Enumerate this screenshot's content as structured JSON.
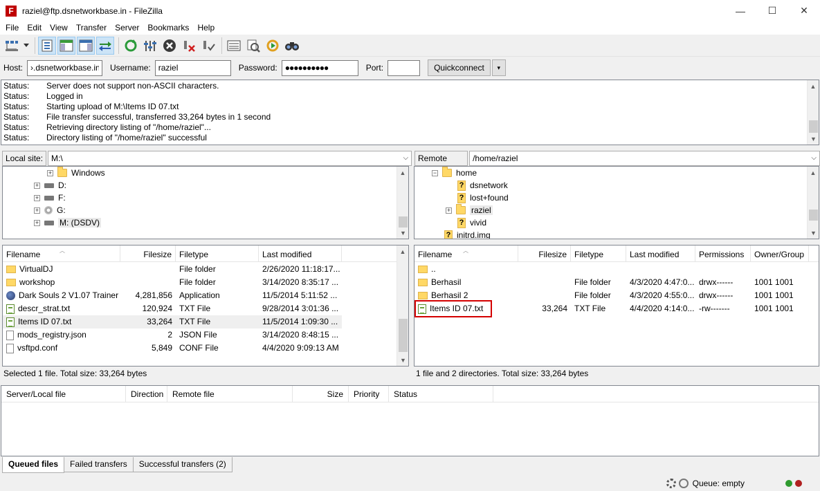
{
  "window": {
    "title": "raziel@ftp.dsnetworkbase.in - FileZilla",
    "app_icon_letter": "F",
    "minimize": "—",
    "maximize": "☐",
    "close": "✕"
  },
  "menu": [
    "File",
    "Edit",
    "View",
    "Transfer",
    "Server",
    "Bookmarks",
    "Help"
  ],
  "toolbar": {
    "icons": [
      "site-manager-icon",
      "dropdown-arrow-icon",
      "toggle-log-icon",
      "toggle-local-tree-icon",
      "toggle-remote-tree-icon",
      "toggle-queue-icon",
      "refresh-icon",
      "process-queue-icon",
      "cancel-icon",
      "disconnect-icon",
      "reconnect-icon",
      "directory-listing-filters-icon",
      "toggle-comparison-icon",
      "sync-browsing-icon",
      "search-files-icon"
    ]
  },
  "quickconnect": {
    "host_label": "Host:",
    "host_value": "›.dsnetworkbase.in",
    "username_label": "Username:",
    "username_value": "raziel",
    "password_label": "Password:",
    "password_value": "●●●●●●●●●●",
    "port_label": "Port:",
    "port_value": "",
    "button_label": "Quickconnect",
    "dropdown": "▾"
  },
  "log": [
    {
      "type": "Status:",
      "message": "Server does not support non-ASCII characters."
    },
    {
      "type": "Status:",
      "message": "Logged in"
    },
    {
      "type": "Status:",
      "message": "Starting upload of M:\\Items ID 07.txt"
    },
    {
      "type": "Status:",
      "message": "File transfer successful, transferred 33,264 bytes in 1 second"
    },
    {
      "type": "Status:",
      "message": "Retrieving directory listing of \"/home/raziel\"..."
    },
    {
      "type": "Status:",
      "message": "Directory listing of \"/home/raziel\" successful"
    }
  ],
  "local": {
    "site_label": "Local site:",
    "site_path": "M:\\",
    "tree": [
      {
        "label": "Windows",
        "expander": "+",
        "icon": "folder-icon"
      },
      {
        "label": "D:",
        "expander": "+",
        "icon": "drive-icon"
      },
      {
        "label": "F:",
        "expander": "+",
        "icon": "drive-icon"
      },
      {
        "label": "G:",
        "expander": "+",
        "icon": "cd-icon"
      },
      {
        "label": "M: (DSDV)",
        "expander": "+",
        "icon": "drive-icon"
      }
    ],
    "columns": {
      "name": "Filename",
      "size": "Filesize",
      "type": "Filetype",
      "modified": "Last modified"
    },
    "files": [
      {
        "name": "VirtualDJ",
        "size": "",
        "type": "File folder",
        "modified": "2/26/2020 11:18:17...",
        "icon": "folder-icon"
      },
      {
        "name": "workshop",
        "size": "",
        "type": "File folder",
        "modified": "3/14/2020 8:35:17 ...",
        "icon": "folder-icon"
      },
      {
        "name": "Dark Souls 2 V1.07 Trainer ...",
        "size": "4,281,856",
        "type": "Application",
        "modified": "11/5/2014 5:11:52 ...",
        "icon": "application-icon"
      },
      {
        "name": "descr_strat.txt",
        "size": "120,924",
        "type": "TXT File",
        "modified": "9/28/2014 3:01:36 ...",
        "icon": "text-file-icon"
      },
      {
        "name": "Items ID 07.txt",
        "size": "33,264",
        "type": "TXT File",
        "modified": "11/5/2014 1:09:30 ...",
        "icon": "text-file-icon"
      },
      {
        "name": "mods_registry.json",
        "size": "2",
        "type": "JSON File",
        "modified": "3/14/2020 8:48:15 ...",
        "icon": "file-icon"
      },
      {
        "name": "vsftpd.conf",
        "size": "5,849",
        "type": "CONF File",
        "modified": "4/4/2020 9:09:13 AM",
        "icon": "file-icon"
      }
    ],
    "status": "Selected 1 file. Total size: 33,264 bytes"
  },
  "remote": {
    "site_label": "Remote site:",
    "site_path": "/home/raziel",
    "tree": [
      {
        "label": "home",
        "expander": "−",
        "icon": "folder-icon"
      },
      {
        "label": "dsnetwork",
        "expander": "",
        "icon": "unknown-folder-icon"
      },
      {
        "label": "lost+found",
        "expander": "",
        "icon": "unknown-folder-icon"
      },
      {
        "label": "raziel",
        "expander": "+",
        "icon": "folder-icon"
      },
      {
        "label": "vivid",
        "expander": "",
        "icon": "unknown-folder-icon"
      },
      {
        "label": "initrd.img",
        "expander": "",
        "icon": "unknown-folder-icon"
      }
    ],
    "unknown_glyph": "?",
    "columns": {
      "name": "Filename",
      "size": "Filesize",
      "type": "Filetype",
      "modified": "Last modified",
      "permissions": "Permissions",
      "owner": "Owner/Group"
    },
    "files": [
      {
        "name": "..",
        "size": "",
        "type": "",
        "modified": "",
        "permissions": "",
        "owner": "",
        "icon": "folder-icon"
      },
      {
        "name": "Berhasil",
        "size": "",
        "type": "File folder",
        "modified": "4/3/2020 4:47:0...",
        "permissions": "drwx------",
        "owner": "1001 1001",
        "icon": "folder-icon"
      },
      {
        "name": "Berhasil 2",
        "size": "",
        "type": "File folder",
        "modified": "4/3/2020 4:55:0...",
        "permissions": "drwx------",
        "owner": "1001 1001",
        "icon": "folder-icon"
      },
      {
        "name": "Items ID 07.txt",
        "size": "33,264",
        "type": "TXT File",
        "modified": "4/4/2020 4:14:0...",
        "permissions": "-rw-------",
        "owner": "1001 1001",
        "icon": "text-file-icon"
      }
    ],
    "status": "1 file and 2 directories. Total size: 33,264 bytes"
  },
  "queue": {
    "columns": {
      "server_local": "Server/Local file",
      "direction": "Direction",
      "remote": "Remote file",
      "size": "Size",
      "priority": "Priority",
      "status": "Status"
    },
    "tabs": [
      "Queued files",
      "Failed transfers",
      "Successful transfers (2)"
    ]
  },
  "statusbar": {
    "queue": "Queue: empty"
  },
  "colors": {
    "highlight_box": "#d40000",
    "led_green": "#2e9a2e",
    "led_red": "#b02020"
  }
}
